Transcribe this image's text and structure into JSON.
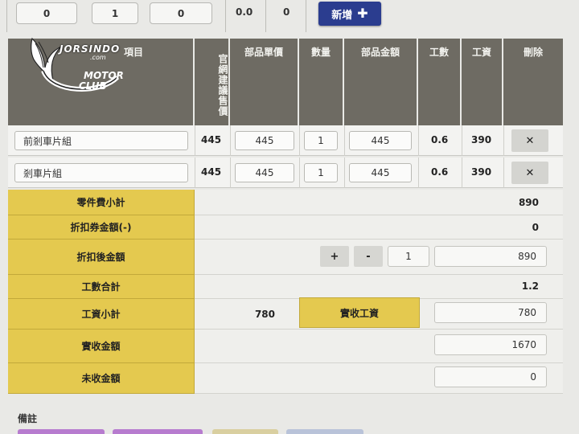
{
  "top_row": {
    "values": [
      "0",
      "1",
      "0",
      "0.0",
      "0"
    ],
    "add_button": "新增",
    "add_icon": "plus-icon"
  },
  "logo": {
    "line1": "JORSINDO",
    "line2": ".com",
    "line3": "MOTOR",
    "line4": "CLUB"
  },
  "header": {
    "col_item": "項目",
    "col_suggest_price": "官網建議售價",
    "col_unit_price": "部品單價",
    "col_qty": "數量",
    "col_parts_amount": "部品金額",
    "col_labor_units": "工數",
    "col_labor_cost": "工資",
    "col_delete": "刪除"
  },
  "items": [
    {
      "name": "前剎車片組",
      "suggest_price": "445",
      "unit_price": "445",
      "qty": "1",
      "amount": "445",
      "labor_units": "0.6",
      "labor_cost": "390",
      "delete": "✕"
    },
    {
      "name": "剎車片組",
      "suggest_price": "445",
      "unit_price": "445",
      "qty": "1",
      "amount": "445",
      "labor_units": "0.6",
      "labor_cost": "390",
      "delete": "✕"
    }
  ],
  "summary": {
    "parts_subtotal_label": "零件費小計",
    "parts_subtotal": "890",
    "coupon_label": "折扣券金額(-)",
    "coupon": "0",
    "discounted_label": "折扣後金額",
    "plus": "+",
    "minus": "-",
    "multiplier": "1",
    "discounted": "890",
    "labor_total_label": "工數合計",
    "labor_total": "1.2",
    "wage_subtotal_label": "工資小計",
    "wage_subtotal": "780",
    "actual_wage_label": "實收工資",
    "actual_wage": "780",
    "actual_amount_label": "實收金額",
    "actual_amount": "1670",
    "unpaid_label": "未收金額",
    "unpaid": "0"
  },
  "notes_label": "備註",
  "colors": {
    "header_bg": "#6e6b63",
    "label_yellow": "#e4c94f",
    "add_button": "#2b3d8f"
  }
}
